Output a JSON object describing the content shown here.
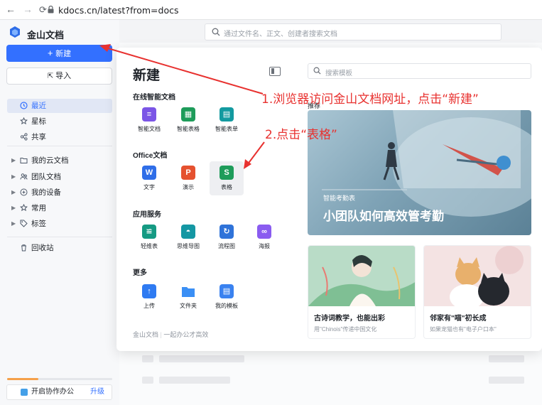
{
  "browser": {
    "url": "kdocs.cn/latest?from=docs"
  },
  "app": {
    "name": "金山文档"
  },
  "search": {
    "placeholder": "通过文件名、正文、创建者搜索文档"
  },
  "sidebar": {
    "new_label": "新建",
    "import_label": "导入",
    "items": [
      {
        "label": "最近",
        "icon": "clock-icon",
        "active": true
      },
      {
        "label": "星标",
        "icon": "star-icon"
      },
      {
        "label": "共享",
        "icon": "share-icon"
      },
      {
        "label": "我的云文档",
        "icon": "folder-icon"
      },
      {
        "label": "团队文档",
        "icon": "team-icon"
      },
      {
        "label": "我的设备",
        "icon": "device-icon"
      },
      {
        "label": "常用",
        "icon": "pin-icon"
      },
      {
        "label": "标签",
        "icon": "tag-icon"
      },
      {
        "label": "回收站",
        "icon": "trash-icon"
      }
    ],
    "collab_label": "开启协作办公",
    "upgrade_label": "升级"
  },
  "modal": {
    "title": "新建",
    "sections": {
      "online": "在线智能文档",
      "office": "Office文档",
      "apps": "应用服务",
      "more": "更多"
    },
    "online_items": [
      {
        "label": "智能文档",
        "color": "#7b55e6"
      },
      {
        "label": "智能表格",
        "color": "#1e9c5a"
      },
      {
        "label": "智能表单",
        "color": "#139aa0"
      }
    ],
    "office_items": [
      {
        "label": "文字",
        "glyph": "W",
        "color": "#2f6ee8"
      },
      {
        "label": "演示",
        "glyph": "P",
        "color": "#e5512f"
      },
      {
        "label": "表格",
        "glyph": "S",
        "color": "#1e9c5a"
      }
    ],
    "app_items": [
      {
        "label": "轻维表",
        "color": "#159a83"
      },
      {
        "label": "思维导图",
        "color": "#1497a3"
      },
      {
        "label": "流程图",
        "color": "#2f73d9"
      },
      {
        "label": "海报",
        "color": "#8a5cf0"
      }
    ],
    "more_items": [
      {
        "label": "上传",
        "color": "#2f7bf2"
      },
      {
        "label": "文件夹",
        "color": "#3a8ff5"
      },
      {
        "label": "我的模板",
        "color": "#3a82f0"
      }
    ],
    "footer_brand": "金山文档",
    "footer_slogan": "一起办公才高效",
    "template_search_placeholder": "搜索模板",
    "recommend_label": "推荐",
    "banner_tag": "智能考勤表",
    "banner_title": "小团队如何高效管考勤",
    "cards": [
      {
        "title": "古诗词教学，也能出彩",
        "subtitle": "用\"Chinois\"传递中国文化"
      },
      {
        "title": "邻家有\"喵\"初长成",
        "subtitle": "如果宠猫也有\"电子户口本\""
      }
    ]
  },
  "annotations": {
    "step1": "1.浏览器访问金山文档网址，点击“新建”",
    "step2": "2.点击“表格”"
  }
}
